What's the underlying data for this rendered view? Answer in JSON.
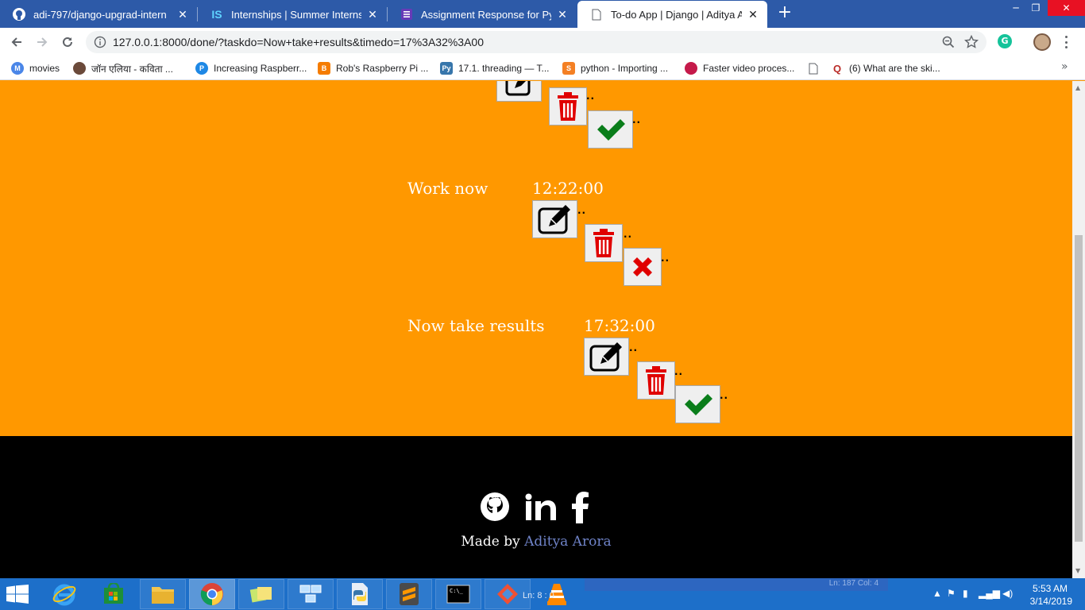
{
  "browser": {
    "tabs": [
      {
        "title": "adi-797/django-upgrad-intern",
        "icon": "github-icon",
        "active": false
      },
      {
        "title": "Internships | Summer Internship",
        "icon": "internshala-icon",
        "active": false
      },
      {
        "title": "Assignment Response for Python",
        "icon": "forms-icon",
        "active": false
      },
      {
        "title": "To-do App | Django | Aditya Aro",
        "icon": "page-icon",
        "active": true
      }
    ],
    "url": "127.0.0.1:8000/done/?taskdo=Now+take+results&timedo=17%3A32%3A00",
    "bookmarks": [
      {
        "label": "movies",
        "icon": "movies-icon",
        "color": "#4a86e8"
      },
      {
        "label": "जॉन एलिया - कविता ...",
        "icon": "avatar-icon",
        "color": "#6b4a3a"
      },
      {
        "label": "Increasing Raspberr...",
        "icon": "p-icon",
        "color": "#1e88e5"
      },
      {
        "label": "Rob's Raspberry Pi ...",
        "icon": "blogger-icon",
        "color": "#f57c00"
      },
      {
        "label": "17.1. threading — T...",
        "icon": "python-icon",
        "color": "#3776ab"
      },
      {
        "label": "python - Importing ...",
        "icon": "stackoverflow-icon",
        "color": "#f48024"
      },
      {
        "label": "Faster video proces...",
        "icon": "raspberry-icon",
        "color": "#c51a4a"
      },
      {
        "label": "",
        "icon": "page-icon",
        "color": "#ffffff"
      },
      {
        "label": "(6) What are the ski...",
        "icon": "quora-icon",
        "color": "#b92b27"
      }
    ]
  },
  "tasks": [
    {
      "name": "",
      "time": ""
    },
    {
      "name": "Work now",
      "time": "12:22:00",
      "done": false
    },
    {
      "name": "Now take results",
      "time": "17:32:00",
      "done": true
    }
  ],
  "colors": {
    "page_bg": "#ff9800",
    "footer_bg": "#000000",
    "author_link": "#6f83c8",
    "delete": "#e00000",
    "check": "#0a7d1a",
    "cross": "#e00000"
  },
  "footer": {
    "made_by": "Made by",
    "author": "Aditya Arora",
    "social": [
      "github-icon",
      "linkedin-icon",
      "facebook-icon"
    ]
  },
  "taskbar": {
    "editor_status": "Ln: 187   Col: 4",
    "overlay_status": "Ln: 8      : 0",
    "time": "5:53 AM",
    "date": "3/14/2019"
  }
}
